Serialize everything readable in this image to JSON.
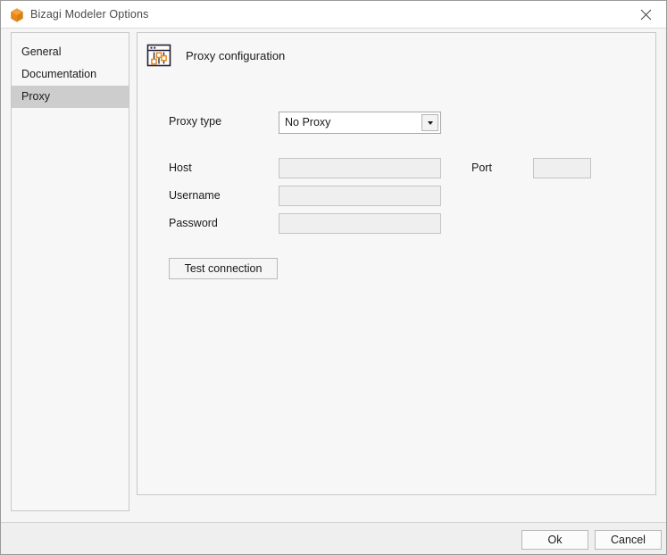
{
  "window": {
    "title": "Bizagi Modeler Options",
    "app_icon": "bizagi-hexagon-icon",
    "close_icon": "close-icon"
  },
  "sidebar": {
    "items": [
      {
        "label": "General",
        "selected": false
      },
      {
        "label": "Documentation",
        "selected": false
      },
      {
        "label": "Proxy",
        "selected": true
      }
    ]
  },
  "content": {
    "section_icon": "settings-sliders-icon",
    "section_title": "Proxy configuration",
    "fields": {
      "proxy_type": {
        "label": "Proxy type",
        "value": "No Proxy",
        "caret_icon": "chevron-down-icon"
      },
      "host": {
        "label": "Host",
        "value": "",
        "placeholder": "",
        "disabled": true
      },
      "port": {
        "label": "Port",
        "value": "",
        "placeholder": "",
        "disabled": true
      },
      "username": {
        "label": "Username",
        "value": "",
        "placeholder": "",
        "disabled": true
      },
      "password": {
        "label": "Password",
        "value": "",
        "placeholder": "",
        "disabled": true
      }
    },
    "test_connection_label": "Test connection"
  },
  "footer": {
    "ok_label": "Ok",
    "cancel_label": "Cancel"
  },
  "colors": {
    "accent_orange": "#E8891C",
    "selection_gray": "#CDCDCD",
    "panel_bg": "#F7F7F7",
    "window_bg": "#F5F5F5",
    "field_disabled": "#EFEFEF"
  }
}
